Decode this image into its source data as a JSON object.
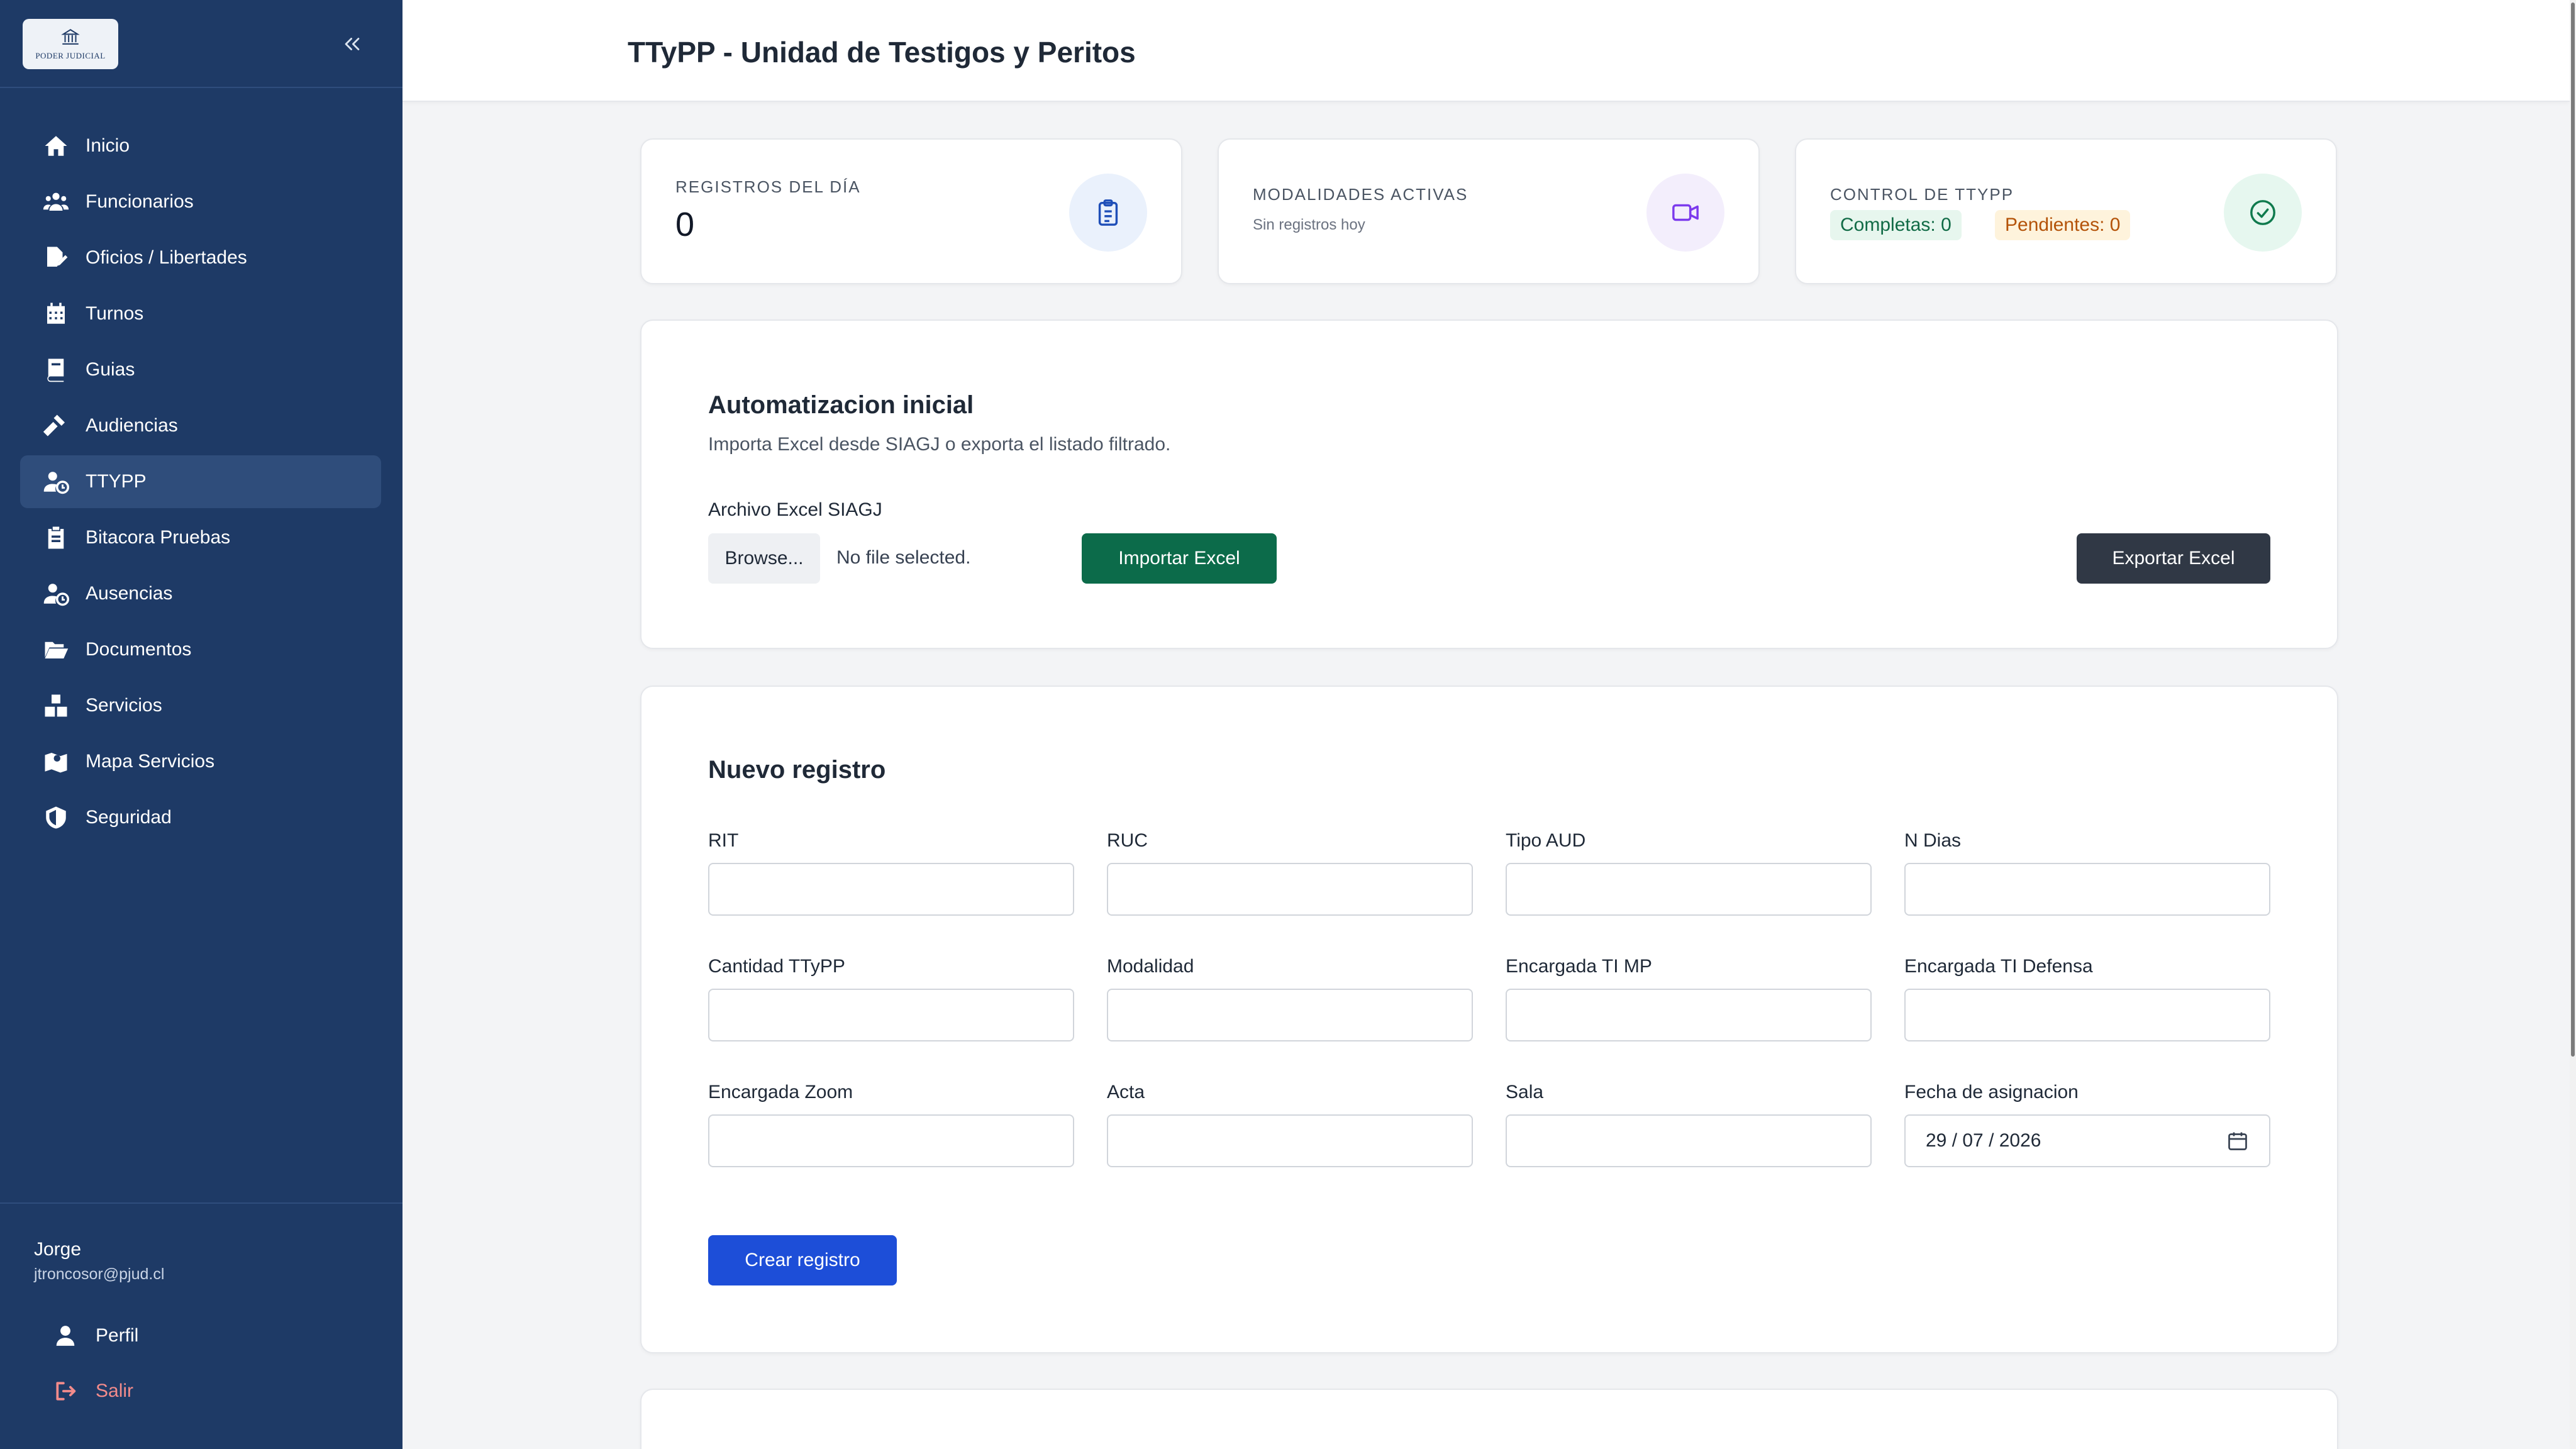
{
  "sidebar": {
    "logo_text": "PODER JUDICIAL",
    "items": [
      {
        "label": "Inicio",
        "icon": "home-icon"
      },
      {
        "label": "Funcionarios",
        "icon": "users-icon"
      },
      {
        "label": "Oficios / Libertades",
        "icon": "file-signature-icon"
      },
      {
        "label": "Turnos",
        "icon": "calendar-icon"
      },
      {
        "label": "Guias",
        "icon": "book-icon"
      },
      {
        "label": "Audiencias",
        "icon": "gavel-icon"
      },
      {
        "label": "TTYPP",
        "icon": "user-clock-icon",
        "active": true
      },
      {
        "label": "Bitacora Pruebas",
        "icon": "clipboard-icon"
      },
      {
        "label": "Ausencias",
        "icon": "user-clock-icon"
      },
      {
        "label": "Documentos",
        "icon": "folder-open-icon"
      },
      {
        "label": "Servicios",
        "icon": "boxes-icon"
      },
      {
        "label": "Mapa Servicios",
        "icon": "map-icon"
      },
      {
        "label": "Seguridad",
        "icon": "shield-icon"
      }
    ],
    "user": {
      "name": "Jorge",
      "email": "jtroncosor@pjud.cl"
    },
    "profile_label": "Perfil",
    "logout_label": "Salir"
  },
  "header": {
    "title": "TTyPP - Unidad de Testigos y Peritos"
  },
  "stats": {
    "registros": {
      "label": "REGISTROS DEL DÍA",
      "value": "0",
      "icon": "clipboard-list-icon"
    },
    "modalidades": {
      "label": "MODALIDADES ACTIVAS",
      "sub": "Sin registros hoy",
      "icon": "video-icon"
    },
    "control": {
      "label": "CONTROL DE TTYPP",
      "completas": "Completas: 0",
      "pendientes": "Pendientes: 0",
      "icon": "check-circle-icon"
    }
  },
  "automation": {
    "title": "Automatizacion inicial",
    "description": "Importa Excel desde SIAGJ o exporta el listado filtrado.",
    "file_label": "Archivo Excel SIAGJ",
    "browse_label": "Browse...",
    "no_file": "No file selected.",
    "import_label": "Importar Excel",
    "export_label": "Exportar Excel"
  },
  "new_record": {
    "title": "Nuevo registro",
    "fields": {
      "rit": {
        "label": "RIT",
        "value": ""
      },
      "ruc": {
        "label": "RUC",
        "value": ""
      },
      "tipo_aud": {
        "label": "Tipo AUD",
        "value": ""
      },
      "n_dias": {
        "label": "N Dias",
        "value": ""
      },
      "cantidad": {
        "label": "Cantidad TTyPP",
        "value": ""
      },
      "modalidad": {
        "label": "Modalidad",
        "value": ""
      },
      "ti_mp": {
        "label": "Encargada TI MP",
        "value": ""
      },
      "ti_defensa": {
        "label": "Encargada TI Defensa",
        "value": ""
      },
      "zoom": {
        "label": "Encargada Zoom",
        "value": ""
      },
      "acta": {
        "label": "Acta",
        "value": ""
      },
      "sala": {
        "label": "Sala",
        "value": ""
      },
      "fecha": {
        "label": "Fecha de asignacion",
        "value": "29 / 07 / 2026"
      }
    },
    "submit_label": "Crear registro"
  },
  "colors": {
    "sidebar_bg": "#1e3a66",
    "active_item_bg": "#2f4d7b",
    "import_btn": "#0c6b4a",
    "export_btn": "#303845",
    "create_btn": "#1d4ed8",
    "logout_text": "#f28b8b"
  }
}
